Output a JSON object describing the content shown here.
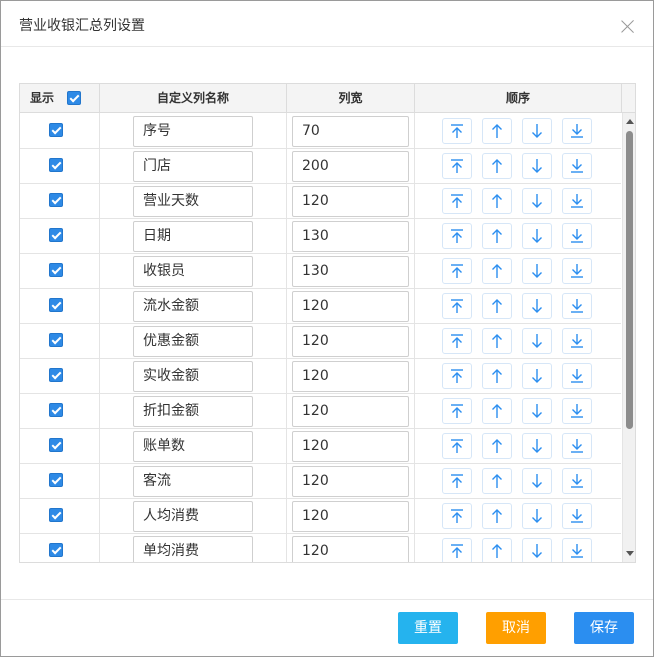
{
  "dialog": {
    "title": "营业收银汇总列设置"
  },
  "table": {
    "headers": {
      "show": "显示",
      "name": "自定义列名称",
      "width": "列宽",
      "order": "顺序"
    },
    "rows": [
      {
        "checked": true,
        "name": "序号",
        "width": "70"
      },
      {
        "checked": true,
        "name": "门店",
        "width": "200"
      },
      {
        "checked": true,
        "name": "营业天数",
        "width": "120"
      },
      {
        "checked": true,
        "name": "日期",
        "width": "130"
      },
      {
        "checked": true,
        "name": "收银员",
        "width": "130"
      },
      {
        "checked": true,
        "name": "流水金额",
        "width": "120"
      },
      {
        "checked": true,
        "name": "优惠金额",
        "width": "120"
      },
      {
        "checked": true,
        "name": "实收金额",
        "width": "120"
      },
      {
        "checked": true,
        "name": "折扣金额",
        "width": "120"
      },
      {
        "checked": true,
        "name": "账单数",
        "width": "120"
      },
      {
        "checked": true,
        "name": "客流",
        "width": "120"
      },
      {
        "checked": true,
        "name": "人均消费",
        "width": "120"
      },
      {
        "checked": true,
        "name": "单均消费",
        "width": "120"
      }
    ],
    "order_icons": [
      "move-top-icon",
      "move-up-icon",
      "move-down-icon",
      "move-bottom-icon"
    ]
  },
  "footer": {
    "reset_label": "重置",
    "cancel_label": "取消",
    "save_label": "保存"
  },
  "colors": {
    "checkbox": "#2e8ae6",
    "order_icon": "#2b8ef0",
    "reset": "#25b3ee",
    "cancel": "#ff9f00",
    "save": "#2b8ef0"
  }
}
